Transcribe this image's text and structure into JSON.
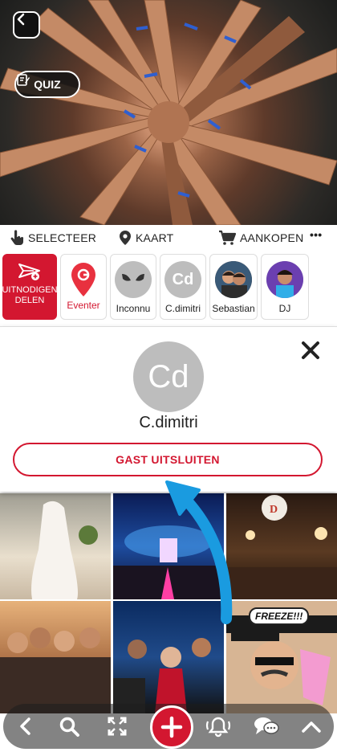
{
  "hero": {
    "quiz_label": "QUIZ"
  },
  "toolbar": {
    "select_label": "SELECTEER",
    "map_label": "KAART",
    "buy_label": "AANKOPEN",
    "more_label": "•••"
  },
  "strip": {
    "share_label_line1": "UITNODIGEN",
    "share_label_line2": "DELEN",
    "eventer_label": "Eventer",
    "inconnu_label": "Inconnu",
    "cdimitri_label": "C.dimitri",
    "cdimitri_initials": "Cd",
    "sebastian_label": "Sebastian",
    "dj_label": "DJ"
  },
  "panel": {
    "initials": "Cd",
    "name": "C.dimitri",
    "exclude_label": "GAST UITSLUITEN"
  },
  "grid": {
    "freeze_text": "FREEZE!!!"
  },
  "colors": {
    "accent": "#d31730",
    "arrow": "#1a9be0"
  }
}
